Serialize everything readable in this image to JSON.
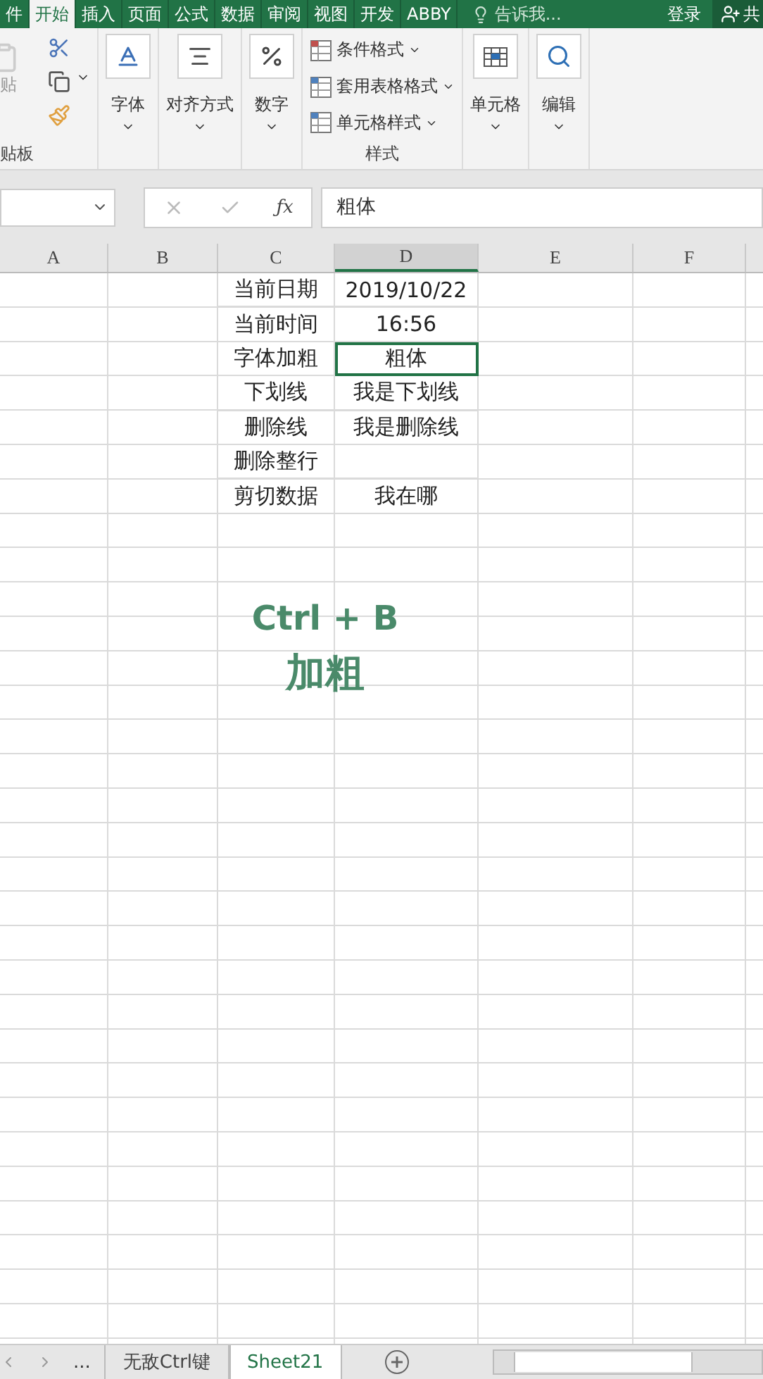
{
  "ribbon_tabs": [
    {
      "label": "件",
      "selected": false
    },
    {
      "label": "开始",
      "selected": true
    },
    {
      "label": "插入",
      "selected": false
    },
    {
      "label": "页面",
      "selected": false
    },
    {
      "label": "公式",
      "selected": false
    },
    {
      "label": "数据",
      "selected": false
    },
    {
      "label": "审阅",
      "selected": false
    },
    {
      "label": "视图",
      "selected": false
    },
    {
      "label": "开发",
      "selected": false
    },
    {
      "label": "ABBY",
      "selected": false
    }
  ],
  "tell_me": "告诉我...",
  "sign_in": "登录",
  "share": "共",
  "clipboard": {
    "paste": "贴",
    "label": "贴板"
  },
  "big_groups": [
    {
      "kind": "font",
      "label": "字体"
    },
    {
      "kind": "align",
      "label": "对齐方式"
    },
    {
      "kind": "number",
      "label": "数字"
    }
  ],
  "styles": {
    "items": [
      "条件格式",
      "套用表格格式",
      "单元格样式"
    ],
    "label": "样式"
  },
  "end_groups": [
    {
      "kind": "cells",
      "label": "单元格"
    },
    {
      "kind": "edit",
      "label": "编辑"
    }
  ],
  "formula_bar": {
    "function_label": "ƒx",
    "value": "粗体"
  },
  "columns": [
    {
      "label": "A",
      "selected": false
    },
    {
      "label": "B",
      "selected": false
    },
    {
      "label": "C",
      "selected": false
    },
    {
      "label": "D",
      "selected": true
    },
    {
      "label": "E",
      "selected": false
    },
    {
      "label": "F",
      "selected": false
    }
  ],
  "rows": [
    {
      "label": "当前日期",
      "value": "2019/10/22",
      "selected": false
    },
    {
      "label": "当前时间",
      "value": "16:56",
      "selected": false
    },
    {
      "label": "字体加粗",
      "value": "粗体",
      "selected": true
    },
    {
      "label": "下划线",
      "value": "我是下划线",
      "selected": false
    },
    {
      "label": "删除线",
      "value": "我是删除线",
      "selected": false
    },
    {
      "label": "删除整行",
      "selected": false
    },
    {
      "label": "剪切数据",
      "value": "我在哪",
      "selected": false
    }
  ],
  "overlay": {
    "shortcut": "Ctrl + B",
    "caption": "加粗"
  },
  "sheet_nav_more": "...",
  "sheet_tabs": [
    {
      "label": "无敌Ctrl键",
      "selected": false
    },
    {
      "label": "Sheet21",
      "selected": true
    }
  ]
}
